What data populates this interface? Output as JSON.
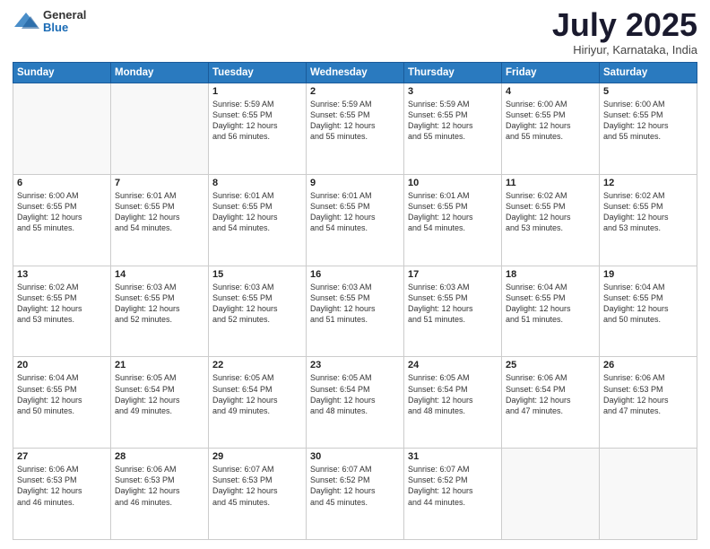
{
  "header": {
    "logo_general": "General",
    "logo_blue": "Blue",
    "title": "July 2025",
    "location": "Hiriyur, Karnataka, India"
  },
  "weekdays": [
    "Sunday",
    "Monday",
    "Tuesday",
    "Wednesday",
    "Thursday",
    "Friday",
    "Saturday"
  ],
  "weeks": [
    [
      {
        "day": "",
        "detail": ""
      },
      {
        "day": "",
        "detail": ""
      },
      {
        "day": "1",
        "detail": "Sunrise: 5:59 AM\nSunset: 6:55 PM\nDaylight: 12 hours\nand 56 minutes."
      },
      {
        "day": "2",
        "detail": "Sunrise: 5:59 AM\nSunset: 6:55 PM\nDaylight: 12 hours\nand 55 minutes."
      },
      {
        "day": "3",
        "detail": "Sunrise: 5:59 AM\nSunset: 6:55 PM\nDaylight: 12 hours\nand 55 minutes."
      },
      {
        "day": "4",
        "detail": "Sunrise: 6:00 AM\nSunset: 6:55 PM\nDaylight: 12 hours\nand 55 minutes."
      },
      {
        "day": "5",
        "detail": "Sunrise: 6:00 AM\nSunset: 6:55 PM\nDaylight: 12 hours\nand 55 minutes."
      }
    ],
    [
      {
        "day": "6",
        "detail": "Sunrise: 6:00 AM\nSunset: 6:55 PM\nDaylight: 12 hours\nand 55 minutes."
      },
      {
        "day": "7",
        "detail": "Sunrise: 6:01 AM\nSunset: 6:55 PM\nDaylight: 12 hours\nand 54 minutes."
      },
      {
        "day": "8",
        "detail": "Sunrise: 6:01 AM\nSunset: 6:55 PM\nDaylight: 12 hours\nand 54 minutes."
      },
      {
        "day": "9",
        "detail": "Sunrise: 6:01 AM\nSunset: 6:55 PM\nDaylight: 12 hours\nand 54 minutes."
      },
      {
        "day": "10",
        "detail": "Sunrise: 6:01 AM\nSunset: 6:55 PM\nDaylight: 12 hours\nand 54 minutes."
      },
      {
        "day": "11",
        "detail": "Sunrise: 6:02 AM\nSunset: 6:55 PM\nDaylight: 12 hours\nand 53 minutes."
      },
      {
        "day": "12",
        "detail": "Sunrise: 6:02 AM\nSunset: 6:55 PM\nDaylight: 12 hours\nand 53 minutes."
      }
    ],
    [
      {
        "day": "13",
        "detail": "Sunrise: 6:02 AM\nSunset: 6:55 PM\nDaylight: 12 hours\nand 53 minutes."
      },
      {
        "day": "14",
        "detail": "Sunrise: 6:03 AM\nSunset: 6:55 PM\nDaylight: 12 hours\nand 52 minutes."
      },
      {
        "day": "15",
        "detail": "Sunrise: 6:03 AM\nSunset: 6:55 PM\nDaylight: 12 hours\nand 52 minutes."
      },
      {
        "day": "16",
        "detail": "Sunrise: 6:03 AM\nSunset: 6:55 PM\nDaylight: 12 hours\nand 51 minutes."
      },
      {
        "day": "17",
        "detail": "Sunrise: 6:03 AM\nSunset: 6:55 PM\nDaylight: 12 hours\nand 51 minutes."
      },
      {
        "day": "18",
        "detail": "Sunrise: 6:04 AM\nSunset: 6:55 PM\nDaylight: 12 hours\nand 51 minutes."
      },
      {
        "day": "19",
        "detail": "Sunrise: 6:04 AM\nSunset: 6:55 PM\nDaylight: 12 hours\nand 50 minutes."
      }
    ],
    [
      {
        "day": "20",
        "detail": "Sunrise: 6:04 AM\nSunset: 6:55 PM\nDaylight: 12 hours\nand 50 minutes."
      },
      {
        "day": "21",
        "detail": "Sunrise: 6:05 AM\nSunset: 6:54 PM\nDaylight: 12 hours\nand 49 minutes."
      },
      {
        "day": "22",
        "detail": "Sunrise: 6:05 AM\nSunset: 6:54 PM\nDaylight: 12 hours\nand 49 minutes."
      },
      {
        "day": "23",
        "detail": "Sunrise: 6:05 AM\nSunset: 6:54 PM\nDaylight: 12 hours\nand 48 minutes."
      },
      {
        "day": "24",
        "detail": "Sunrise: 6:05 AM\nSunset: 6:54 PM\nDaylight: 12 hours\nand 48 minutes."
      },
      {
        "day": "25",
        "detail": "Sunrise: 6:06 AM\nSunset: 6:54 PM\nDaylight: 12 hours\nand 47 minutes."
      },
      {
        "day": "26",
        "detail": "Sunrise: 6:06 AM\nSunset: 6:53 PM\nDaylight: 12 hours\nand 47 minutes."
      }
    ],
    [
      {
        "day": "27",
        "detail": "Sunrise: 6:06 AM\nSunset: 6:53 PM\nDaylight: 12 hours\nand 46 minutes."
      },
      {
        "day": "28",
        "detail": "Sunrise: 6:06 AM\nSunset: 6:53 PM\nDaylight: 12 hours\nand 46 minutes."
      },
      {
        "day": "29",
        "detail": "Sunrise: 6:07 AM\nSunset: 6:53 PM\nDaylight: 12 hours\nand 45 minutes."
      },
      {
        "day": "30",
        "detail": "Sunrise: 6:07 AM\nSunset: 6:52 PM\nDaylight: 12 hours\nand 45 minutes."
      },
      {
        "day": "31",
        "detail": "Sunrise: 6:07 AM\nSunset: 6:52 PM\nDaylight: 12 hours\nand 44 minutes."
      },
      {
        "day": "",
        "detail": ""
      },
      {
        "day": "",
        "detail": ""
      }
    ]
  ]
}
